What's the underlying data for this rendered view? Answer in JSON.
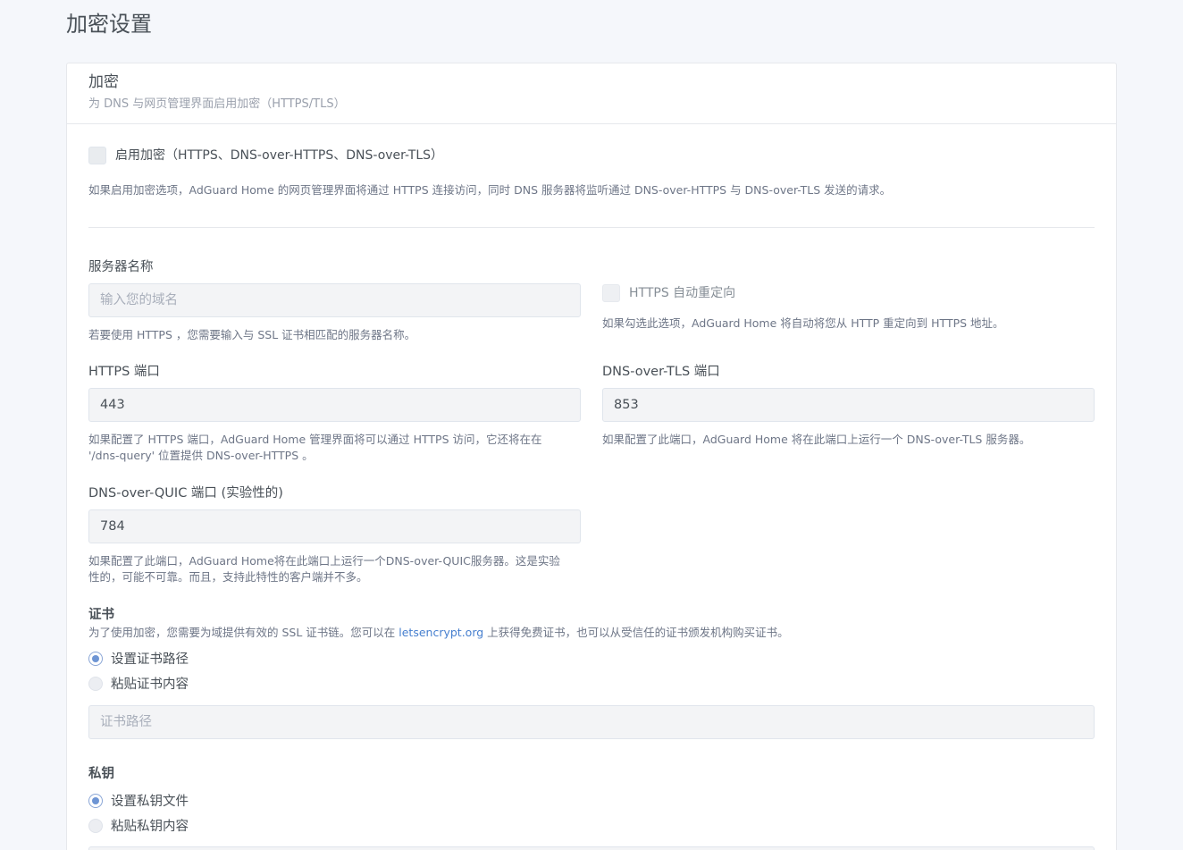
{
  "page": {
    "title": "加密设置"
  },
  "encryption_card": {
    "title": "加密",
    "subtitle": "为 DNS 与网页管理界面启用加密（HTTPS/TLS）"
  },
  "enable_encryption": {
    "label": "启用加密（HTTPS、DNS-over-HTTPS、DNS-over-TLS）",
    "help": "如果启用加密选项，AdGuard Home 的网页管理界面将通过 HTTPS 连接访问，同时 DNS 服务器将监听通过 DNS-over-HTTPS 与 DNS-over-TLS 发送的请求。"
  },
  "server_name": {
    "label": "服务器名称",
    "value": "",
    "placeholder": "输入您的域名",
    "help": "若要使用 HTTPS ，您需要输入与 SSL 证书相匹配的服务器名称。"
  },
  "https_redirect": {
    "label": "HTTPS 自动重定向",
    "help": "如果勾选此选项，AdGuard Home 将自动将您从 HTTP 重定向到 HTTPS 地址。"
  },
  "https_port": {
    "label": "HTTPS 端口",
    "value": "443",
    "help_line1": "如果配置了 HTTPS 端口，AdGuard Home 管理界面将可以通过 HTTPS 访问，它还将在在",
    "help_line2": "'/dns-query' 位置提供 DNS-over-HTTPS 。"
  },
  "dot_port": {
    "label": "DNS-over-TLS 端口",
    "value": "853",
    "help": "如果配置了此端口，AdGuard Home 将在此端口上运行一个 DNS-over-TLS 服务器。"
  },
  "doq_port": {
    "label": "DNS-over-QUIC 端口 (实验性的)",
    "value": "784",
    "help_line1": "如果配置了此端口，AdGuard Home将在此端口上运行一个DNS-over-QUIC服务器。这是实验",
    "help_line2": "性的，可能不可靠。而且，支持此特性的客户端并不多。"
  },
  "certificate": {
    "title": "证书",
    "help_before": "为了使用加密，您需要为域提供有效的 SSL 证书链。您可以在 ",
    "help_link": "letsencrypt.org",
    "help_after": " 上获得免费证书，也可以从受信任的证书颁发机构购买证书。",
    "option_path": "设置证书路径",
    "option_paste": "粘贴证书内容",
    "path_placeholder": "证书路径",
    "path_value": ""
  },
  "private_key": {
    "title": "私钥",
    "option_file": "设置私钥文件",
    "option_paste": "粘贴私钥内容"
  },
  "colors": {
    "link": "#467fcf",
    "radio_checked": "#6e95d4",
    "background": "#f5f7fb"
  }
}
